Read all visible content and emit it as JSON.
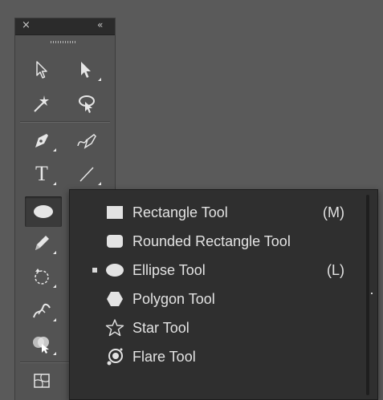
{
  "toolbar": {
    "close_glyph": "×",
    "collapse_glyph": "«",
    "tools": [
      {
        "name": "selection-tool",
        "icon": "selection-arrow-icon"
      },
      {
        "name": "direct-selection-tool",
        "icon": "direct-selection-arrow-icon"
      },
      {
        "name": "magic-wand-tool",
        "icon": "magic-wand-icon"
      },
      {
        "name": "lasso-tool",
        "icon": "lasso-icon"
      },
      {
        "name": "pen-tool",
        "icon": "pen-icon"
      },
      {
        "name": "curvature-tool",
        "icon": "curvature-pen-icon"
      },
      {
        "name": "type-tool",
        "icon": "type-icon",
        "glyph": "T"
      },
      {
        "name": "line-segment-tool",
        "icon": "line-segment-icon"
      },
      {
        "name": "ellipse-tool",
        "icon": "ellipse-icon",
        "selected": true
      },
      {
        "name": "pencil-tool",
        "icon": "pencil-icon"
      },
      {
        "name": "rotate-tool",
        "icon": "rotate-icon"
      },
      {
        "name": "warp-tool",
        "icon": "warp-icon"
      },
      {
        "name": "shape-builder-tool",
        "icon": "shape-builder-icon"
      },
      {
        "name": "mesh-tool",
        "icon": "mesh-icon"
      }
    ]
  },
  "flyout": {
    "items": [
      {
        "label": "Rectangle Tool",
        "shortcut": "(M)",
        "icon": "rectangle-icon",
        "checked": false
      },
      {
        "label": "Rounded Rectangle Tool",
        "shortcut": "",
        "icon": "rounded-rectangle-icon",
        "checked": false
      },
      {
        "label": "Ellipse Tool",
        "shortcut": "(L)",
        "icon": "ellipse-icon",
        "checked": true
      },
      {
        "label": "Polygon Tool",
        "shortcut": "",
        "icon": "polygon-icon",
        "checked": false
      },
      {
        "label": "Star Tool",
        "shortcut": "",
        "icon": "star-icon",
        "checked": false
      },
      {
        "label": "Flare Tool",
        "shortcut": "",
        "icon": "flare-icon",
        "checked": false
      }
    ]
  },
  "colors": {
    "background": "#5a5a5a",
    "panel": "#535353",
    "menu": "#2f2f2f",
    "text": "#e3e3e3"
  }
}
